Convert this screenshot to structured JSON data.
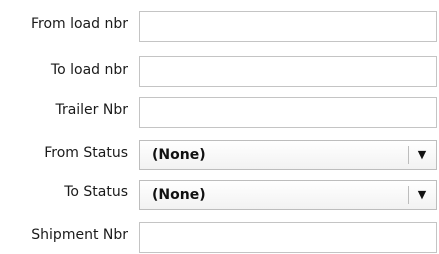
{
  "form": {
    "from_load_nbr": {
      "label": "From load nbr",
      "value": ""
    },
    "to_load_nbr": {
      "label": "To load nbr",
      "value": ""
    },
    "trailer_nbr": {
      "label": "Trailer Nbr",
      "value": ""
    },
    "from_status": {
      "label": "From Status",
      "selected": "(None)",
      "arrow_icon": "triangle-down-icon"
    },
    "to_status": {
      "label": "To Status",
      "selected": "(None)",
      "arrow_icon": "triangle-down-icon"
    },
    "shipment_nbr": {
      "label": "Shipment Nbr",
      "value": ""
    }
  }
}
